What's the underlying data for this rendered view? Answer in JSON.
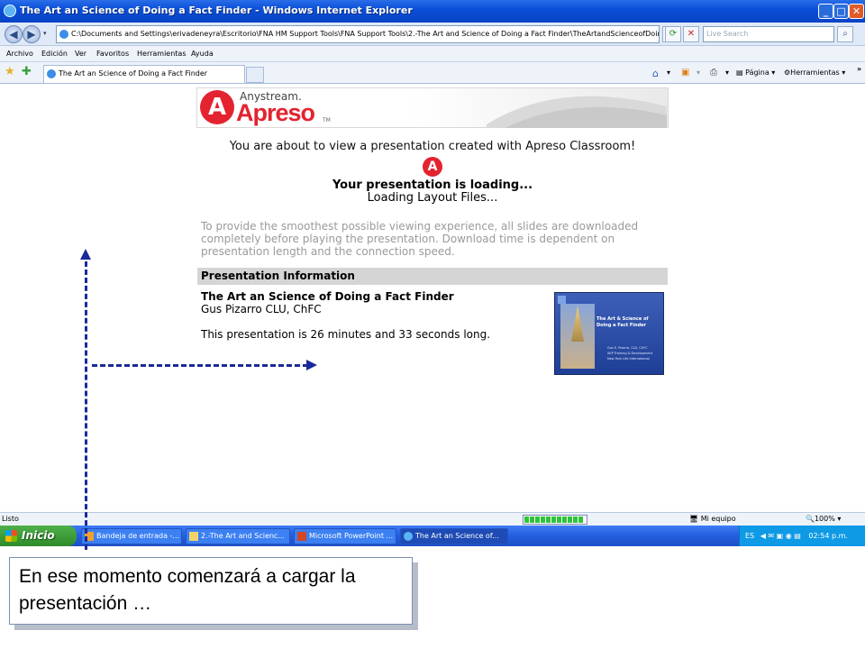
{
  "window": {
    "title": "The Art an Science of Doing a Fact Finder - Windows Internet Explorer",
    "minimize": "_",
    "maximize": "□",
    "close": "✕"
  },
  "address_bar": {
    "url": "C:\\Documents and Settings\\erivadeneyra\\Escritorio\\FNA HM Support Tools\\FNA Support Tools\\2.-The Art and Science of Doing a Fact Finder\\TheArtandScienceofDoingaFactFinde",
    "search_placeholder": "Live Search"
  },
  "menu": [
    "Archivo",
    "Edición",
    "Ver",
    "Favoritos",
    "Herramientas",
    "Ayuda"
  ],
  "tab": {
    "label": "The Art an Science of Doing a Fact Finder"
  },
  "toolbar": {
    "page": "Página",
    "tools": "Herramientas"
  },
  "content": {
    "logo": {
      "anystream": "Anystream.",
      "apreso": "Apreso",
      "tm": "TM",
      "mark": "A"
    },
    "about": "You are about to view a presentation created with Apreso Classroom!",
    "loading_title": "Your presentation is loading...",
    "loading_status": "Loading Layout Files...",
    "smooth_text": "To provide the smoothest possible viewing experience, all slides are downloaded completely before playing the presentation. Download time is dependent on presentation length and the connection speed.",
    "info_header": "Presentation Information",
    "presentation_title": "The Art an Science of Doing a Fact Finder",
    "presenter": "Gus Pizarro CLU, ChFC",
    "length_text": "This presentation is 26 minutes and 33 seconds long.",
    "thumbnail": {
      "title": "The Art & Science of Doing a Fact Finder",
      "subtitle_1": "Gus E. Pizarro, CLU, ChFC",
      "subtitle_2": "AVP Training & Development",
      "subtitle_3": "New York Life International"
    }
  },
  "status_bar": {
    "text": "Listo",
    "zone": "Mi equipo",
    "zoom": "100%",
    "progress_fraction": 1.0
  },
  "taskbar": {
    "start": "Inicio",
    "buttons": [
      "Bandeja de entrada -...",
      "2.-The Art and Scienc...",
      "Microsoft PowerPoint ...",
      "The Art an Science of..."
    ],
    "language": "ES",
    "clock": "02:54 p.m."
  },
  "callout": {
    "text": "En ese momento comenzará a cargar la presentación …"
  }
}
